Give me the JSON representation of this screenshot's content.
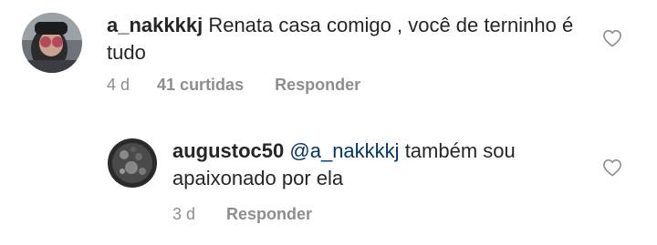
{
  "comments": [
    {
      "username": "a_nakkkkj",
      "text": "Renata casa comigo , você de terninho é tudo",
      "time": "4 d",
      "likes": "41 curtidas",
      "reply_label": "Responder",
      "like_icon": "heart-outline-icon"
    },
    {
      "username": "augustoc50",
      "mention": "@a_nakkkkj",
      "text": "também sou apaixonado por ela",
      "time": "3 d",
      "reply_label": "Responder",
      "like_icon": "heart-outline-icon"
    }
  ]
}
